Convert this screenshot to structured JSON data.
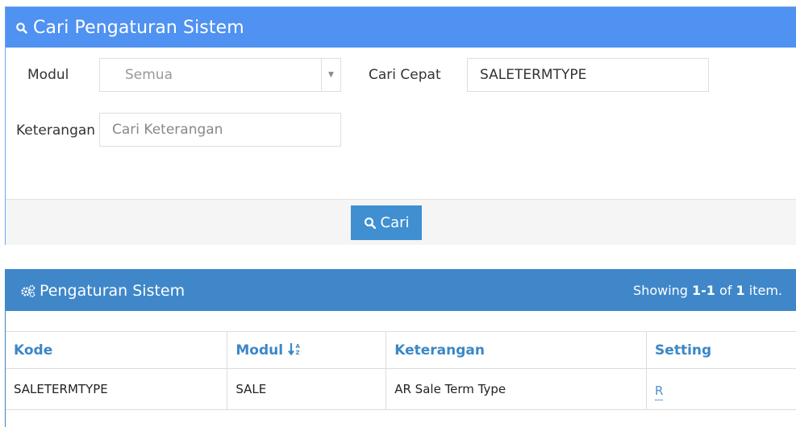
{
  "search": {
    "title": "Cari Pengaturan Sistem",
    "modul_label": "Modul",
    "modul_value": "Semua",
    "quick_label": "Cari Cepat",
    "quick_value": "SALETERMTYPE",
    "desc_label": "Keterangan",
    "desc_placeholder": "Cari Keterangan",
    "button_label": "Cari",
    "icon": "search-icon"
  },
  "results": {
    "title": "Pengaturan Sistem",
    "icon": "gears-icon",
    "summary_prefix": "Showing ",
    "summary_range": "1-1",
    "summary_of": " of ",
    "summary_total": "1",
    "summary_suffix": " item.",
    "columns": {
      "kode": "Kode",
      "modul": "Modul",
      "keterangan": "Keterangan",
      "setting": "Setting"
    },
    "rows": [
      {
        "kode": "SALETERMTYPE",
        "modul": "SALE",
        "keterangan": "AR Sale Term Type",
        "setting": "R"
      }
    ]
  },
  "colors": {
    "search_header": "#4f92f2",
    "results_header": "#3f87c9",
    "button": "#3f8fd1",
    "column_header_text": "#3a87c8"
  }
}
